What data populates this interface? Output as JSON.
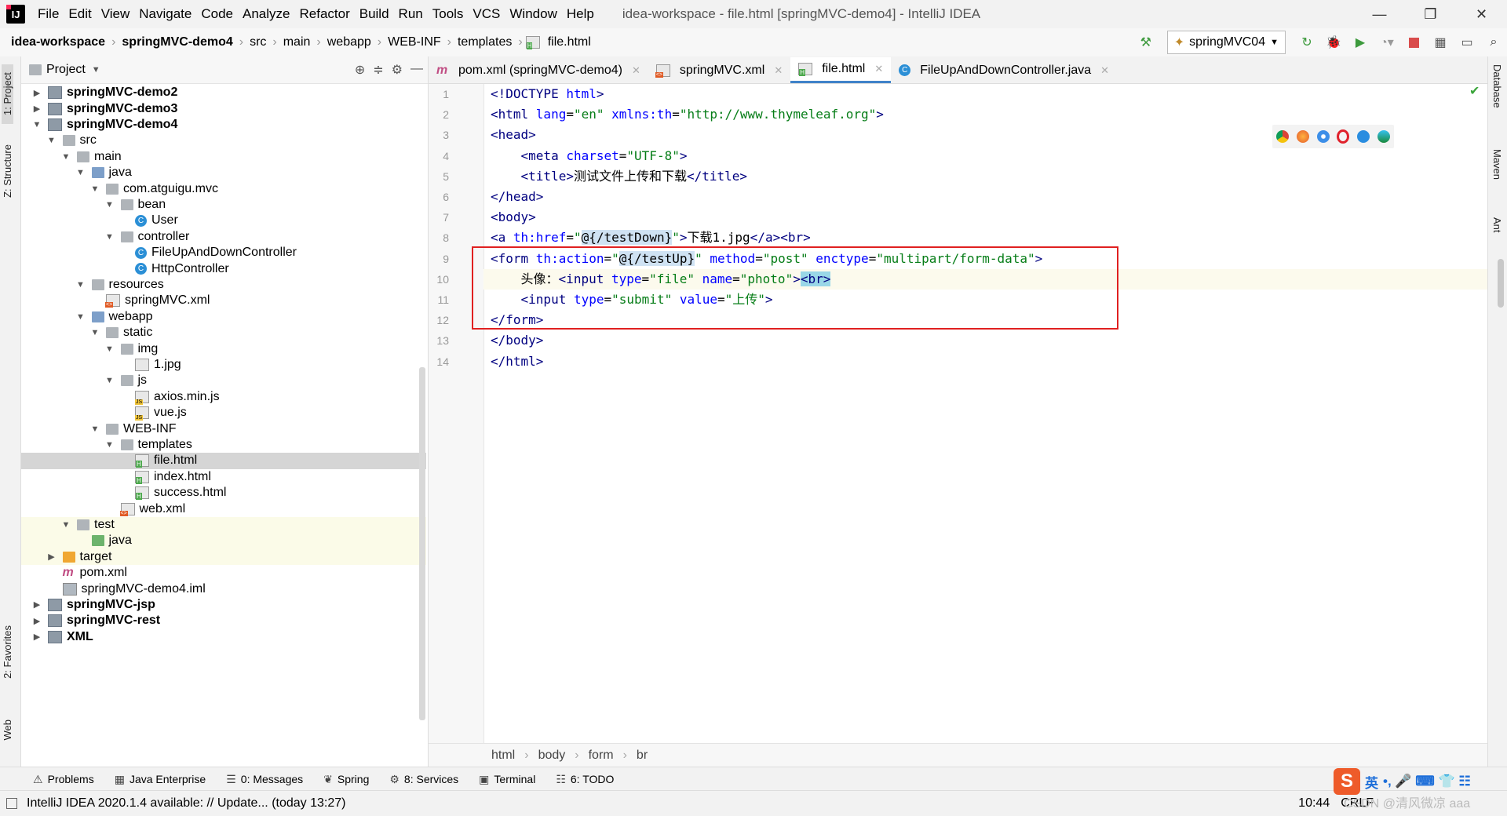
{
  "menubar": {
    "logo_text": "IJ",
    "items": [
      "File",
      "Edit",
      "View",
      "Navigate",
      "Code",
      "Analyze",
      "Refactor",
      "Build",
      "Run",
      "Tools",
      "VCS",
      "Window",
      "Help"
    ],
    "title": "idea-workspace - file.html [springMVC-demo4] - IntelliJ IDEA",
    "window_buttons": [
      "—",
      "❐",
      "✕"
    ]
  },
  "navbar": {
    "crumbs": [
      "idea-workspace",
      "springMVC-demo4",
      "src",
      "main",
      "webapp",
      "WEB-INF",
      "templates",
      "file.html"
    ],
    "run_config": "springMVC04"
  },
  "left_strip": {
    "project_tab": "1: Project",
    "structure_tab": "Z: Structure",
    "favorites_tab": "2: Favorites",
    "web_tab": "Web"
  },
  "project_panel": {
    "title": "Project",
    "tree": [
      {
        "label": "springMVC-demo2",
        "bold": true,
        "depth": 0,
        "arrow": "right",
        "icon": "module"
      },
      {
        "label": "springMVC-demo3",
        "bold": true,
        "depth": 0,
        "arrow": "right",
        "icon": "module"
      },
      {
        "label": "springMVC-demo4",
        "bold": true,
        "depth": 0,
        "arrow": "down",
        "icon": "module"
      },
      {
        "label": "src",
        "depth": 1,
        "arrow": "down",
        "icon": "folder"
      },
      {
        "label": "main",
        "depth": 2,
        "arrow": "down",
        "icon": "folder"
      },
      {
        "label": "java",
        "depth": 3,
        "arrow": "down",
        "icon": "folder-blue"
      },
      {
        "label": "com.atguigu.mvc",
        "depth": 4,
        "arrow": "down",
        "icon": "folder"
      },
      {
        "label": "bean",
        "depth": 5,
        "arrow": "down",
        "icon": "folder"
      },
      {
        "label": "User",
        "depth": 6,
        "arrow": "",
        "icon": "class"
      },
      {
        "label": "controller",
        "depth": 5,
        "arrow": "down",
        "icon": "folder"
      },
      {
        "label": "FileUpAndDownController",
        "depth": 6,
        "arrow": "",
        "icon": "class"
      },
      {
        "label": "HttpController",
        "depth": 6,
        "arrow": "",
        "icon": "class"
      },
      {
        "label": "resources",
        "depth": 3,
        "arrow": "down",
        "icon": "folder"
      },
      {
        "label": "springMVC.xml",
        "depth": 4,
        "arrow": "",
        "icon": "xml"
      },
      {
        "label": "webapp",
        "depth": 3,
        "arrow": "down",
        "icon": "folder-blue"
      },
      {
        "label": "static",
        "depth": 4,
        "arrow": "down",
        "icon": "folder"
      },
      {
        "label": "img",
        "depth": 5,
        "arrow": "down",
        "icon": "folder"
      },
      {
        "label": "1.jpg",
        "depth": 6,
        "arrow": "",
        "icon": "img"
      },
      {
        "label": "js",
        "depth": 5,
        "arrow": "down",
        "icon": "folder"
      },
      {
        "label": "axios.min.js",
        "depth": 6,
        "arrow": "",
        "icon": "js"
      },
      {
        "label": "vue.js",
        "depth": 6,
        "arrow": "",
        "icon": "js"
      },
      {
        "label": "WEB-INF",
        "depth": 4,
        "arrow": "down",
        "icon": "folder"
      },
      {
        "label": "templates",
        "depth": 5,
        "arrow": "down",
        "icon": "folder"
      },
      {
        "label": "file.html",
        "depth": 6,
        "arrow": "",
        "icon": "html",
        "selected": true
      },
      {
        "label": "index.html",
        "depth": 6,
        "arrow": "",
        "icon": "html"
      },
      {
        "label": "success.html",
        "depth": 6,
        "arrow": "",
        "icon": "html"
      },
      {
        "label": "web.xml",
        "depth": 5,
        "arrow": "",
        "icon": "xml"
      },
      {
        "label": "test",
        "depth": 2,
        "arrow": "down",
        "icon": "folder",
        "tint": true
      },
      {
        "label": "java",
        "depth": 3,
        "arrow": "",
        "icon": "folder-green",
        "tint": true
      },
      {
        "label": "target",
        "depth": 1,
        "arrow": "right",
        "icon": "folder-orange",
        "tint": true
      },
      {
        "label": "pom.xml",
        "depth": 1,
        "arrow": "",
        "icon": "maven"
      },
      {
        "label": "springMVC-demo4.iml",
        "depth": 1,
        "arrow": "",
        "icon": "iml"
      },
      {
        "label": "springMVC-jsp",
        "bold": true,
        "depth": 0,
        "arrow": "right",
        "icon": "module"
      },
      {
        "label": "springMVC-rest",
        "bold": true,
        "depth": 0,
        "arrow": "right",
        "icon": "module"
      },
      {
        "label": "XML",
        "bold": true,
        "depth": 0,
        "arrow": "right",
        "icon": "module"
      }
    ]
  },
  "editor_tabs": [
    {
      "label": "pom.xml (springMVC-demo4)",
      "icon": "maven",
      "active": false
    },
    {
      "label": "springMVC.xml",
      "icon": "xml",
      "active": false
    },
    {
      "label": "file.html",
      "icon": "html",
      "active": true
    },
    {
      "label": "FileUpAndDownController.java",
      "icon": "class",
      "active": false
    }
  ],
  "code": {
    "line_numbers": [
      "1",
      "2",
      "3",
      "4",
      "5",
      "6",
      "7",
      "8",
      "9",
      "10",
      "11",
      "12",
      "13",
      "14"
    ],
    "lines": [
      [
        {
          "t": "<!DOCTYPE ",
          "c": "tg"
        },
        {
          "t": "html",
          "c": "at"
        },
        {
          "t": ">",
          "c": "tg"
        }
      ],
      [
        {
          "t": "<html ",
          "c": "tg"
        },
        {
          "t": "lang",
          "c": "at"
        },
        {
          "t": "=",
          "c": ""
        },
        {
          "t": "\"en\"",
          "c": "av"
        },
        {
          "t": " xmlns:th",
          "c": "at"
        },
        {
          "t": "=",
          "c": ""
        },
        {
          "t": "\"http://www.thymeleaf.org\"",
          "c": "av"
        },
        {
          "t": ">",
          "c": "tg"
        }
      ],
      [
        {
          "t": "<head>",
          "c": "tg"
        }
      ],
      [
        {
          "t": "    <meta ",
          "c": "tg"
        },
        {
          "t": "charset",
          "c": "at"
        },
        {
          "t": "=",
          "c": ""
        },
        {
          "t": "\"UTF-8\"",
          "c": "av"
        },
        {
          "t": ">",
          "c": "tg"
        }
      ],
      [
        {
          "t": "    <title>",
          "c": "tg"
        },
        {
          "t": "测试文件上传和下载",
          "c": ""
        },
        {
          "t": "</title>",
          "c": "tg"
        }
      ],
      [
        {
          "t": "</head>",
          "c": "tg"
        }
      ],
      [
        {
          "t": "<body>",
          "c": "tg"
        }
      ],
      [
        {
          "t": "<a ",
          "c": "tg"
        },
        {
          "t": "th:href",
          "c": "at"
        },
        {
          "t": "=",
          "c": ""
        },
        {
          "t": "\"",
          "c": "av"
        },
        {
          "t": "@{/testDown}",
          "c": "hl"
        },
        {
          "t": "\"",
          "c": "av"
        },
        {
          "t": ">",
          "c": "tg"
        },
        {
          "t": "下载1.jpg",
          "c": ""
        },
        {
          "t": "</a><br>",
          "c": "tg"
        }
      ],
      [
        {
          "t": "<form ",
          "c": "tg"
        },
        {
          "t": "th:action",
          "c": "at"
        },
        {
          "t": "=",
          "c": ""
        },
        {
          "t": "\"",
          "c": "av"
        },
        {
          "t": "@{/testUp}",
          "c": "hl"
        },
        {
          "t": "\"",
          "c": "av"
        },
        {
          "t": " method",
          "c": "at"
        },
        {
          "t": "=",
          "c": ""
        },
        {
          "t": "\"post\"",
          "c": "av"
        },
        {
          "t": " enctype",
          "c": "at"
        },
        {
          "t": "=",
          "c": ""
        },
        {
          "t": "\"multipart/form-data\"",
          "c": "av"
        },
        {
          "t": ">",
          "c": "tg"
        }
      ],
      [
        {
          "t": "    头像：",
          "c": ""
        },
        {
          "t": "<input ",
          "c": "tg"
        },
        {
          "t": "type",
          "c": "at"
        },
        {
          "t": "=",
          "c": ""
        },
        {
          "t": "\"file\"",
          "c": "av"
        },
        {
          "t": " name",
          "c": "at"
        },
        {
          "t": "=",
          "c": ""
        },
        {
          "t": "\"photo\"",
          "c": "av"
        },
        {
          "t": ">",
          "c": "tg"
        },
        {
          "t": "<br>",
          "c": "br-hl tg"
        }
      ],
      [
        {
          "t": "    <input ",
          "c": "tg"
        },
        {
          "t": "type",
          "c": "at"
        },
        {
          "t": "=",
          "c": ""
        },
        {
          "t": "\"submit\"",
          "c": "av"
        },
        {
          "t": " value",
          "c": "at"
        },
        {
          "t": "=",
          "c": ""
        },
        {
          "t": "\"上传\"",
          "c": "av"
        },
        {
          "t": ">",
          "c": "tg"
        }
      ],
      [
        {
          "t": "</form>",
          "c": "tg"
        }
      ],
      [
        {
          "t": "</body>",
          "c": "tg"
        }
      ],
      [
        {
          "t": "</html>",
          "c": "tg"
        }
      ]
    ],
    "current_line": 10
  },
  "right_strip": {
    "tabs": [
      "Database",
      "Maven",
      "Ant"
    ]
  },
  "editor_breadcrumbs": [
    "html",
    "body",
    "form",
    "br"
  ],
  "tool_windows": [
    {
      "label": "Problems",
      "icon": "⚠"
    },
    {
      "label": "Java Enterprise",
      "icon": "▦"
    },
    {
      "label": "0: Messages",
      "icon": "☰"
    },
    {
      "label": "Spring",
      "icon": "❦"
    },
    {
      "label": "8: Services",
      "icon": "⚙"
    },
    {
      "label": "Terminal",
      "icon": "▣"
    },
    {
      "label": "6: TODO",
      "icon": "☷"
    }
  ],
  "statusbar": {
    "message": "IntelliJ IDEA 2020.1.4 available: // Update... (today 13:27)",
    "position": "10:44",
    "line_sep": "CRLF"
  },
  "ime": {
    "logo": "S",
    "lang": "英",
    "symbols": "•, 🎤 ⌨ 👕 ☷"
  },
  "watermark": "CSDN @清风微凉 aaa"
}
